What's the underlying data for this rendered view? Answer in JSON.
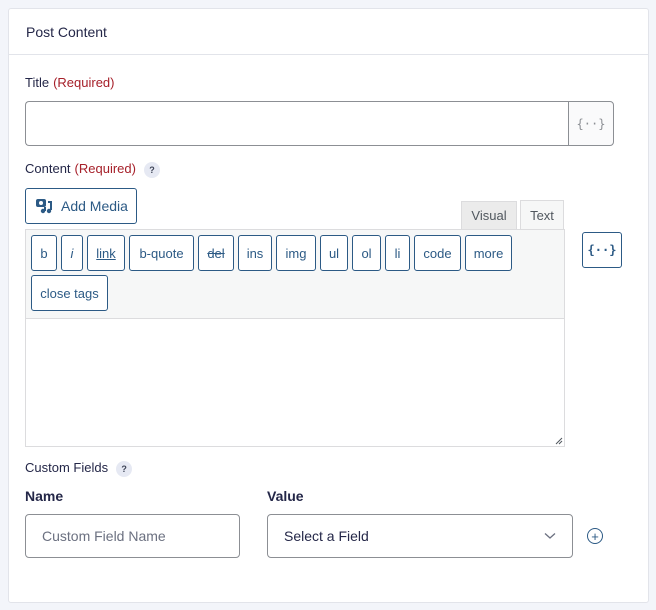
{
  "panel": {
    "title": "Post Content"
  },
  "title_field": {
    "label": "Title",
    "required": "(Required)",
    "value": "",
    "merge_tag_icon": "{··}"
  },
  "content_field": {
    "label": "Content",
    "required": "(Required)",
    "help_icon": "?",
    "add_media_label": "Add Media",
    "tabs": [
      {
        "label": "Visual",
        "active": false
      },
      {
        "label": "Text",
        "active": true
      }
    ],
    "quicktags": [
      "b",
      "i",
      "link",
      "b-quote",
      "del",
      "ins",
      "img",
      "ul",
      "ol",
      "li",
      "code",
      "more",
      "close tags"
    ],
    "value": "",
    "merge_tag_icon": "{··}"
  },
  "custom_fields": {
    "label": "Custom Fields",
    "help_icon": "?",
    "name_header": "Name",
    "value_header": "Value",
    "name_placeholder": "Custom Field Name",
    "value_selected": "Select a Field",
    "add_icon": "+"
  },
  "colors": {
    "accent": "#2c5a85",
    "required": "#a6202a",
    "background": "#f3f5fa"
  }
}
